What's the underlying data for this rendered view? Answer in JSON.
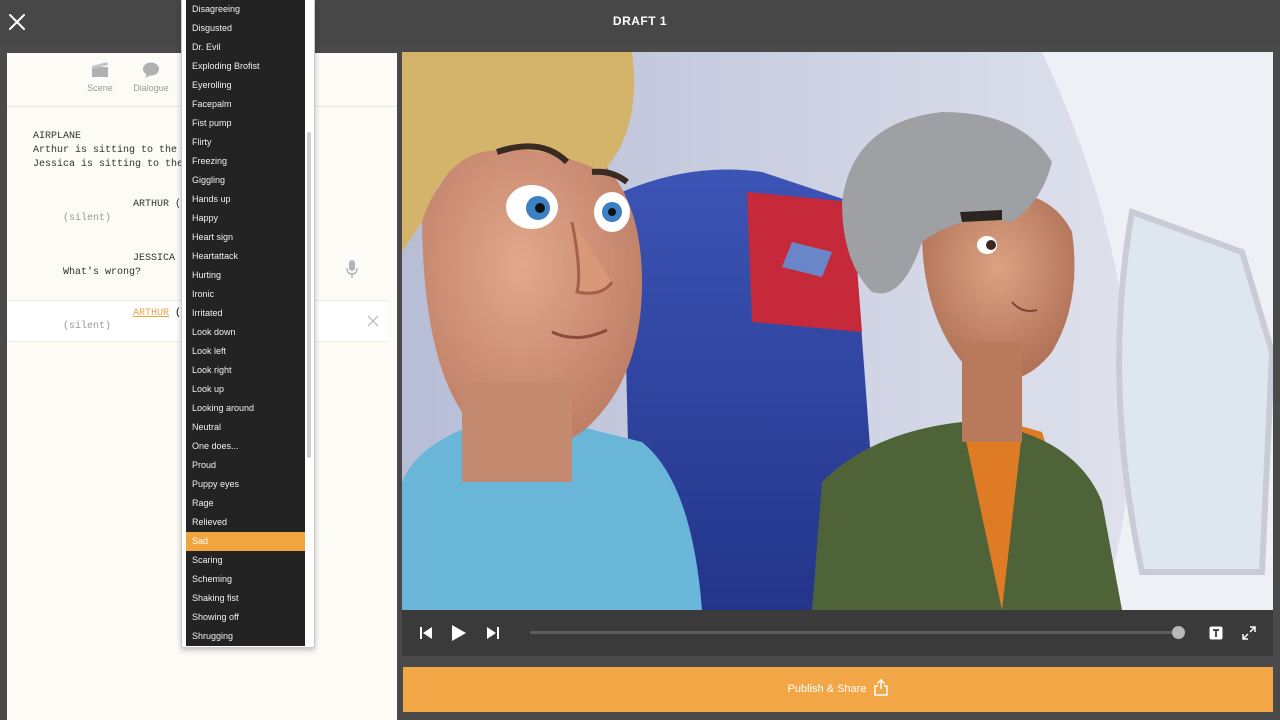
{
  "header": {
    "title": "DRAFT 1"
  },
  "toolbar": {
    "scene_label": "Scene",
    "dialogue_label": "Dialogue"
  },
  "script": {
    "scene_heading": "AIRPLANE",
    "action_1": "Arthur is sitting to the",
    "action_2": "Jessica is sitting to the",
    "block1_character": "ARTHUR (",
    "block1_paren": "(silent)",
    "block2_character": "JESSICA",
    "block2_dialogue": "What's wrong?",
    "block3_character": "ARTHUR",
    "block3_suffix": " (",
    "block3_paren": "(silent)"
  },
  "emotion_menu": {
    "items": [
      "Disagreeing",
      "Disgusted",
      "Dr. Evil",
      "Exploding Brofist",
      "Eyerolling",
      "Facepalm",
      "Fist pump",
      "Flirty",
      "Freezing",
      "Giggling",
      "Hands up",
      "Happy",
      "Heart sign",
      "Heartattack",
      "Hurting",
      "Ironic",
      "Irritated",
      "Look down",
      "Look left",
      "Look right",
      "Look up",
      "Looking around",
      "Neutral",
      "One does...",
      "Proud",
      "Puppy eyes",
      "Rage",
      "Relieved",
      "Sad",
      "Scaring",
      "Scheming",
      "Shaking fist",
      "Showing off",
      "Shrugging"
    ],
    "selected": "Sad"
  },
  "player": {
    "icons": [
      "skip-back-icon",
      "play-icon",
      "skip-forward-icon",
      "text-toggle-icon",
      "fullscreen-icon"
    ],
    "progress": 1.0
  },
  "publish": {
    "label": "Publish & Share"
  },
  "colors": {
    "accent": "#f2a646",
    "selected_item": "#f1a53f",
    "menu_bg": "#232323",
    "panel_bg": "#fdfbf6",
    "topbar_bg": "#474747"
  }
}
